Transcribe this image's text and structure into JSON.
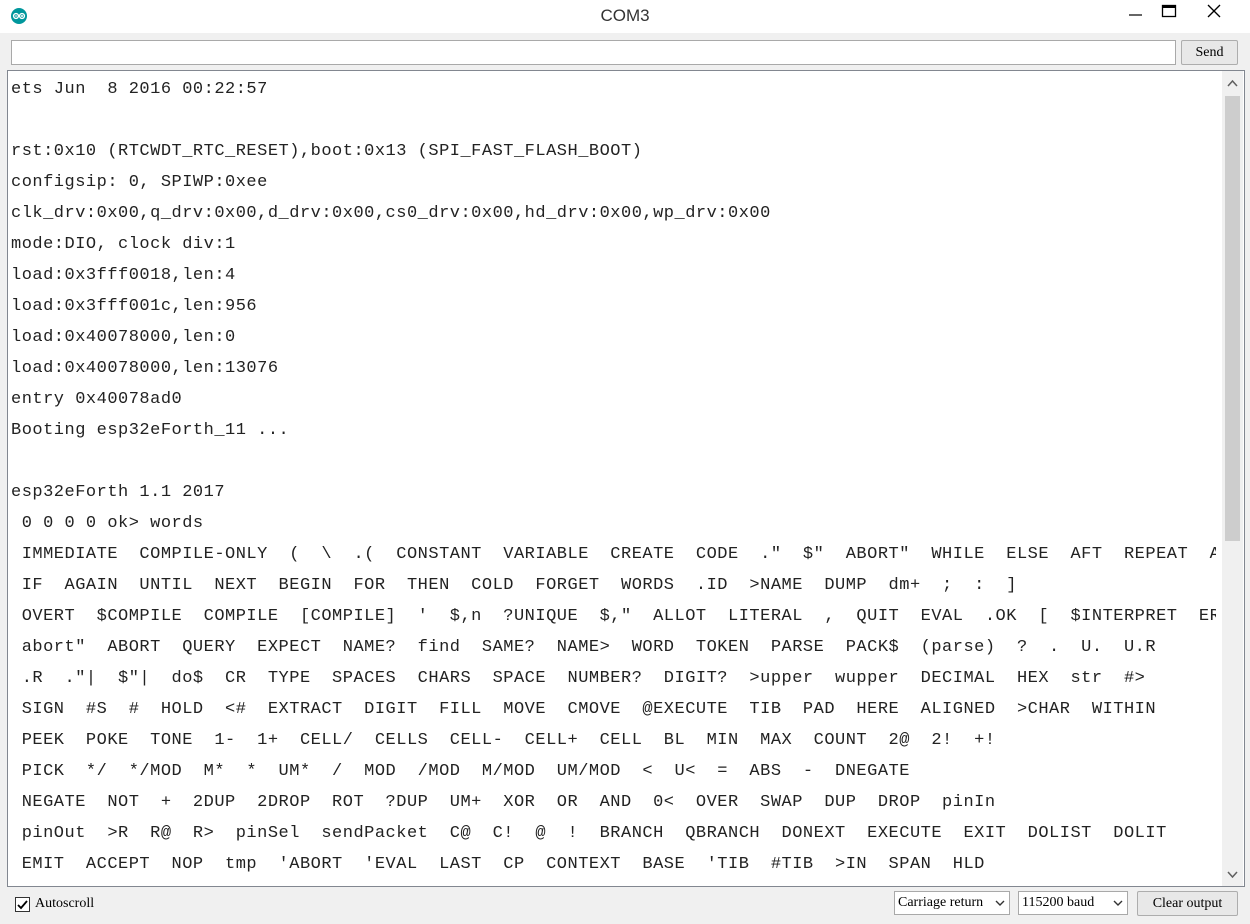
{
  "window": {
    "title": "COM3",
    "icon": "arduino-icon"
  },
  "input": {
    "value": "",
    "send_label": "Send"
  },
  "output": {
    "lines": [
      "ets Jun  8 2016 00:22:57",
      "",
      "rst:0x10 (RTCWDT_RTC_RESET),boot:0x13 (SPI_FAST_FLASH_BOOT)",
      "configsip: 0, SPIWP:0xee",
      "clk_drv:0x00,q_drv:0x00,d_drv:0x00,cs0_drv:0x00,hd_drv:0x00,wp_drv:0x00",
      "mode:DIO, clock div:1",
      "load:0x3fff0018,len:4",
      "load:0x3fff001c,len:956",
      "load:0x40078000,len:0",
      "load:0x40078000,len:13076",
      "entry 0x40078ad0",
      "Booting esp32eForth_11 ...",
      "",
      "esp32eForth 1.1 2017",
      " 0 0 0 0 ok> words",
      " IMMEDIATE  COMPILE-ONLY  (  \\  .(  CONSTANT  VARIABLE  CREATE  CODE  .\"  $\"  ABORT\"  WHILE  ELSE  AFT  REPEAT  AHEAD",
      " IF  AGAIN  UNTIL  NEXT  BEGIN  FOR  THEN  COLD  FORGET  WORDS  .ID  >NAME  DUMP  dm+  ;  :  ]",
      " OVERT  $COMPILE  COMPILE  [COMPILE]  '  $,n  ?UNIQUE  $,\"  ALLOT  LITERAL  ,  QUIT  EVAL  .OK  [  $INTERPRET  ERROR",
      " abort\"  ABORT  QUERY  EXPECT  NAME?  find  SAME?  NAME>  WORD  TOKEN  PARSE  PACK$  (parse)  ?  .  U.  U.R",
      " .R  .\"|  $\"|  do$  CR  TYPE  SPACES  CHARS  SPACE  NUMBER?  DIGIT?  >upper  wupper  DECIMAL  HEX  str  #>",
      " SIGN  #S  #  HOLD  <#  EXTRACT  DIGIT  FILL  MOVE  CMOVE  @EXECUTE  TIB  PAD  HERE  ALIGNED  >CHAR  WITHIN",
      " PEEK  POKE  TONE  1-  1+  CELL/  CELLS  CELL-  CELL+  CELL  BL  MIN  MAX  COUNT  2@  2!  +!",
      " PICK  */  */MOD  M*  *  UM*  /  MOD  /MOD  M/MOD  UM/MOD  <  U<  =  ABS  -  DNEGATE",
      " NEGATE  NOT  +  2DUP  2DROP  ROT  ?DUP  UM+  XOR  OR  AND  0<  OVER  SWAP  DUP  DROP  pinIn",
      " pinOut  >R  R@  R>  pinSel  sendPacket  C@  C!  @  !  BRANCH  QBRANCH  DONEXT  EXECUTE  EXIT  DOLIST  DOLIT",
      " EMIT  ACCEPT  NOP  tmp  'ABORT  'EVAL  LAST  CP  CONTEXT  BASE  'TIB  #TIB  >IN  SPAN  HLD"
    ]
  },
  "footer": {
    "autoscroll_label": "Autoscroll",
    "autoscroll_checked": true,
    "line_ending": "Carriage return",
    "baud_rate": "115200 baud",
    "clear_label": "Clear output"
  },
  "colors": {
    "accent": "#00979c",
    "window_bg": "#f0f0f0",
    "text": "#222222"
  }
}
